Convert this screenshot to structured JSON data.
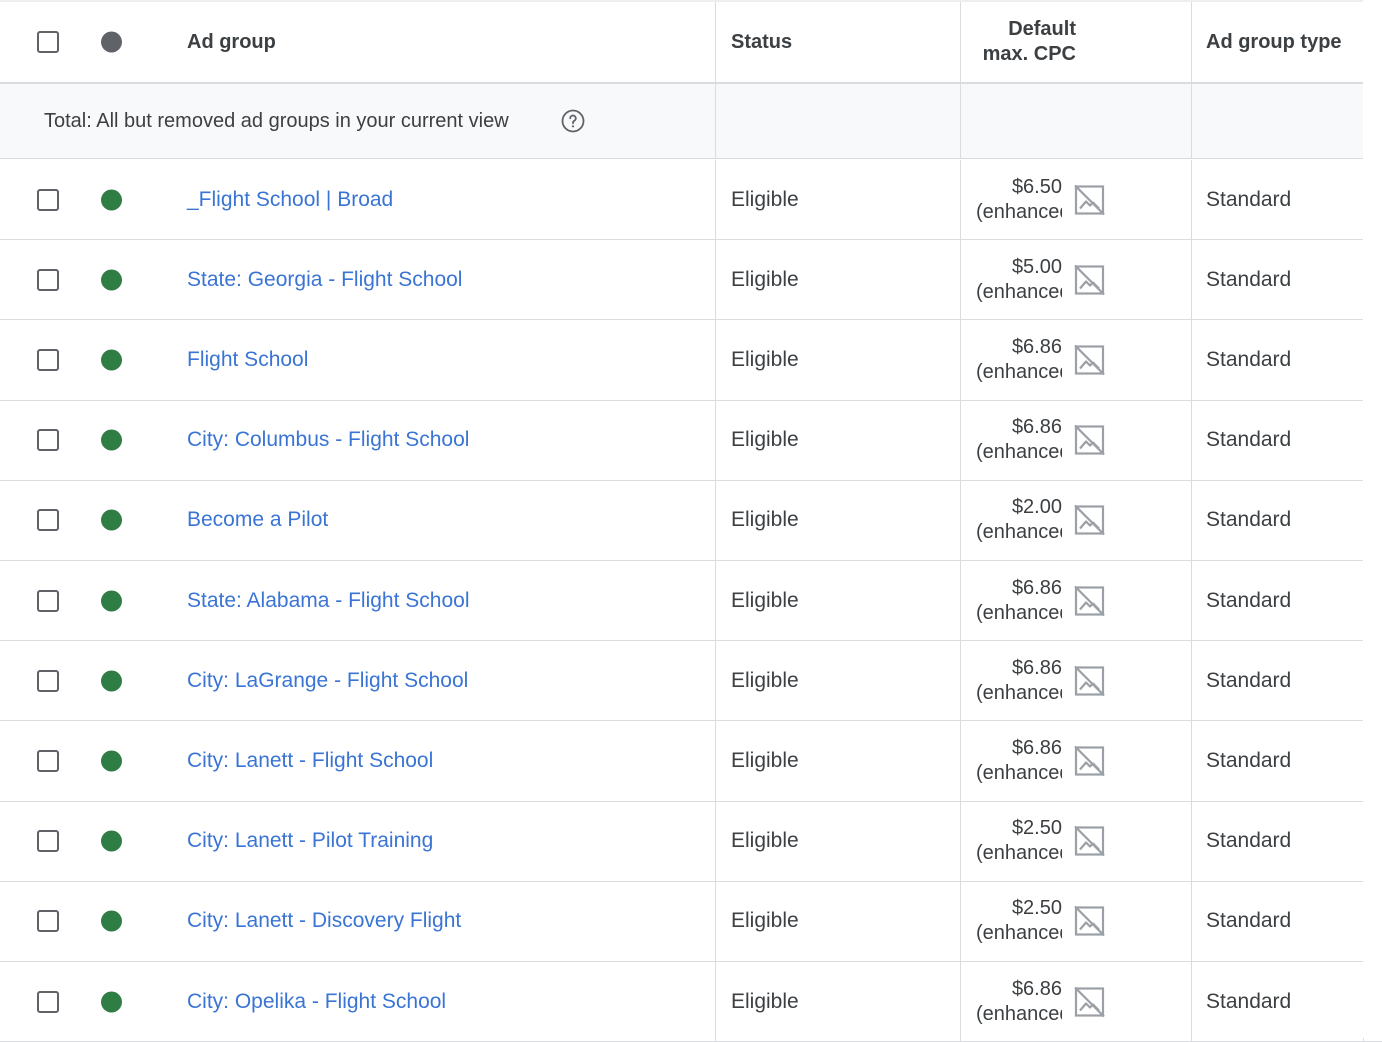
{
  "header": {
    "ad_group": "Ad group",
    "status": "Status",
    "cpc_line1": "Default",
    "cpc_line2": "max. CPC",
    "ad_group_type": "Ad group type"
  },
  "total": {
    "label": "Total: All but removed ad groups in your current view"
  },
  "colors": {
    "eligible_dot": "#2e7d45",
    "header_dot": "#5f6368",
    "link": "#3a74d4"
  },
  "rows": [
    {
      "name": "_Flight School | Broad",
      "status": "Eligible",
      "cpc": "$6.50",
      "cpc_note": "(enhanced)",
      "type": "Standard"
    },
    {
      "name": "State: Georgia - Flight School",
      "status": "Eligible",
      "cpc": "$5.00",
      "cpc_note": "(enhanced)",
      "type": "Standard"
    },
    {
      "name": "Flight School",
      "status": "Eligible",
      "cpc": "$6.86",
      "cpc_note": "(enhanced)",
      "type": "Standard"
    },
    {
      "name": "City: Columbus - Flight School",
      "status": "Eligible",
      "cpc": "$6.86",
      "cpc_note": "(enhanced)",
      "type": "Standard"
    },
    {
      "name": "Become a Pilot",
      "status": "Eligible",
      "cpc": "$2.00",
      "cpc_note": "(enhanced)",
      "type": "Standard"
    },
    {
      "name": "State: Alabama - Flight School",
      "status": "Eligible",
      "cpc": "$6.86",
      "cpc_note": "(enhanced)",
      "type": "Standard"
    },
    {
      "name": "City: LaGrange - Flight School",
      "status": "Eligible",
      "cpc": "$6.86",
      "cpc_note": "(enhanced)",
      "type": "Standard"
    },
    {
      "name": "City: Lanett - Flight School",
      "status": "Eligible",
      "cpc": "$6.86",
      "cpc_note": "(enhanced)",
      "type": "Standard"
    },
    {
      "name": "City: Lanett - Pilot Training",
      "status": "Eligible",
      "cpc": "$2.50",
      "cpc_note": "(enhanced)",
      "type": "Standard"
    },
    {
      "name": "City: Lanett - Discovery Flight",
      "status": "Eligible",
      "cpc": "$2.50",
      "cpc_note": "(enhanced)",
      "type": "Standard"
    },
    {
      "name": "City: Opelika - Flight School",
      "status": "Eligible",
      "cpc": "$6.86",
      "cpc_note": "(enhanced)",
      "type": "Standard"
    }
  ]
}
